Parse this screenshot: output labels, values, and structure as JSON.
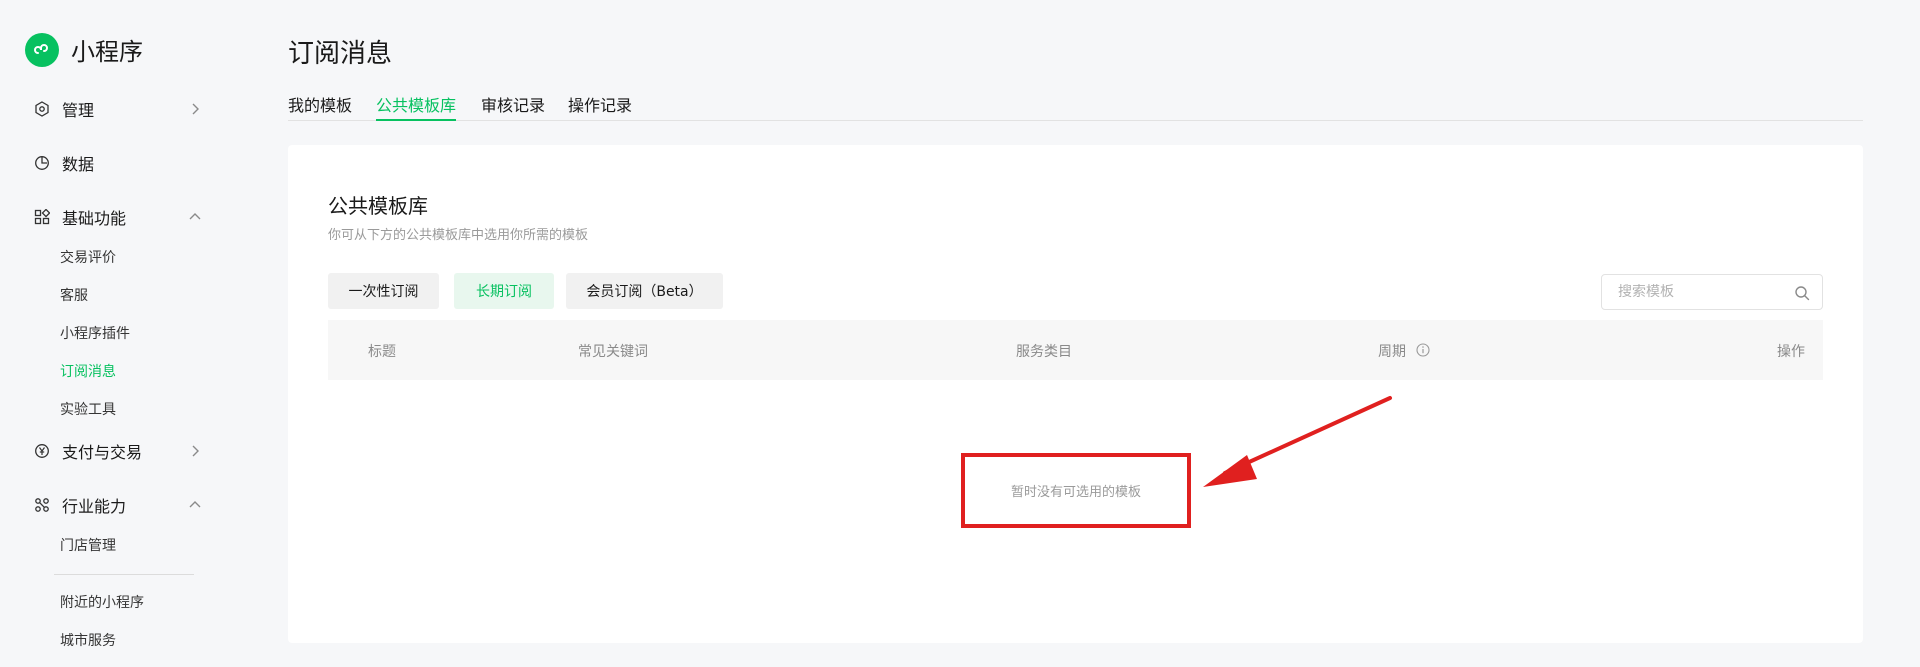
{
  "app": {
    "name": "小程序"
  },
  "sidebar": {
    "sections": [
      {
        "label": "管理",
        "icon": "hexagon-settings-icon",
        "caret": "right"
      },
      {
        "label": "数据",
        "icon": "pie-chart-icon",
        "caret": "none"
      },
      {
        "label": "基础功能",
        "icon": "grid-apps-icon",
        "caret": "up"
      },
      {
        "label": "支付与交易",
        "icon": "yen-icon",
        "caret": "right"
      },
      {
        "label": "行业能力",
        "icon": "industry-nodes-icon",
        "caret": "up"
      }
    ],
    "basic_items": [
      "交易评价",
      "客服",
      "小程序插件",
      "订阅消息",
      "实验工具"
    ],
    "industry_items": [
      "门店管理",
      "附近的小程序",
      "城市服务"
    ],
    "active_item": "订阅消息"
  },
  "page": {
    "title": "订阅消息",
    "tabs": [
      "我的模板",
      "公共模板库",
      "审核记录",
      "操作记录"
    ],
    "active_tab": "公共模板库"
  },
  "card": {
    "title": "公共模板库",
    "description": "你可从下方的公共模板库中选用你所需的模板",
    "filters": [
      "一次性订阅",
      "长期订阅",
      "会员订阅（Beta）"
    ],
    "active_filter": "长期订阅",
    "search_placeholder": "搜索模板",
    "columns": [
      "标题",
      "常见关键词",
      "服务类目",
      "周期",
      "操作"
    ],
    "empty_text": "暂时没有可选用的模板"
  },
  "colors": {
    "brand_green": "#07c160",
    "annotation_red": "#e0201f",
    "page_bg": "#f6f7f9"
  }
}
